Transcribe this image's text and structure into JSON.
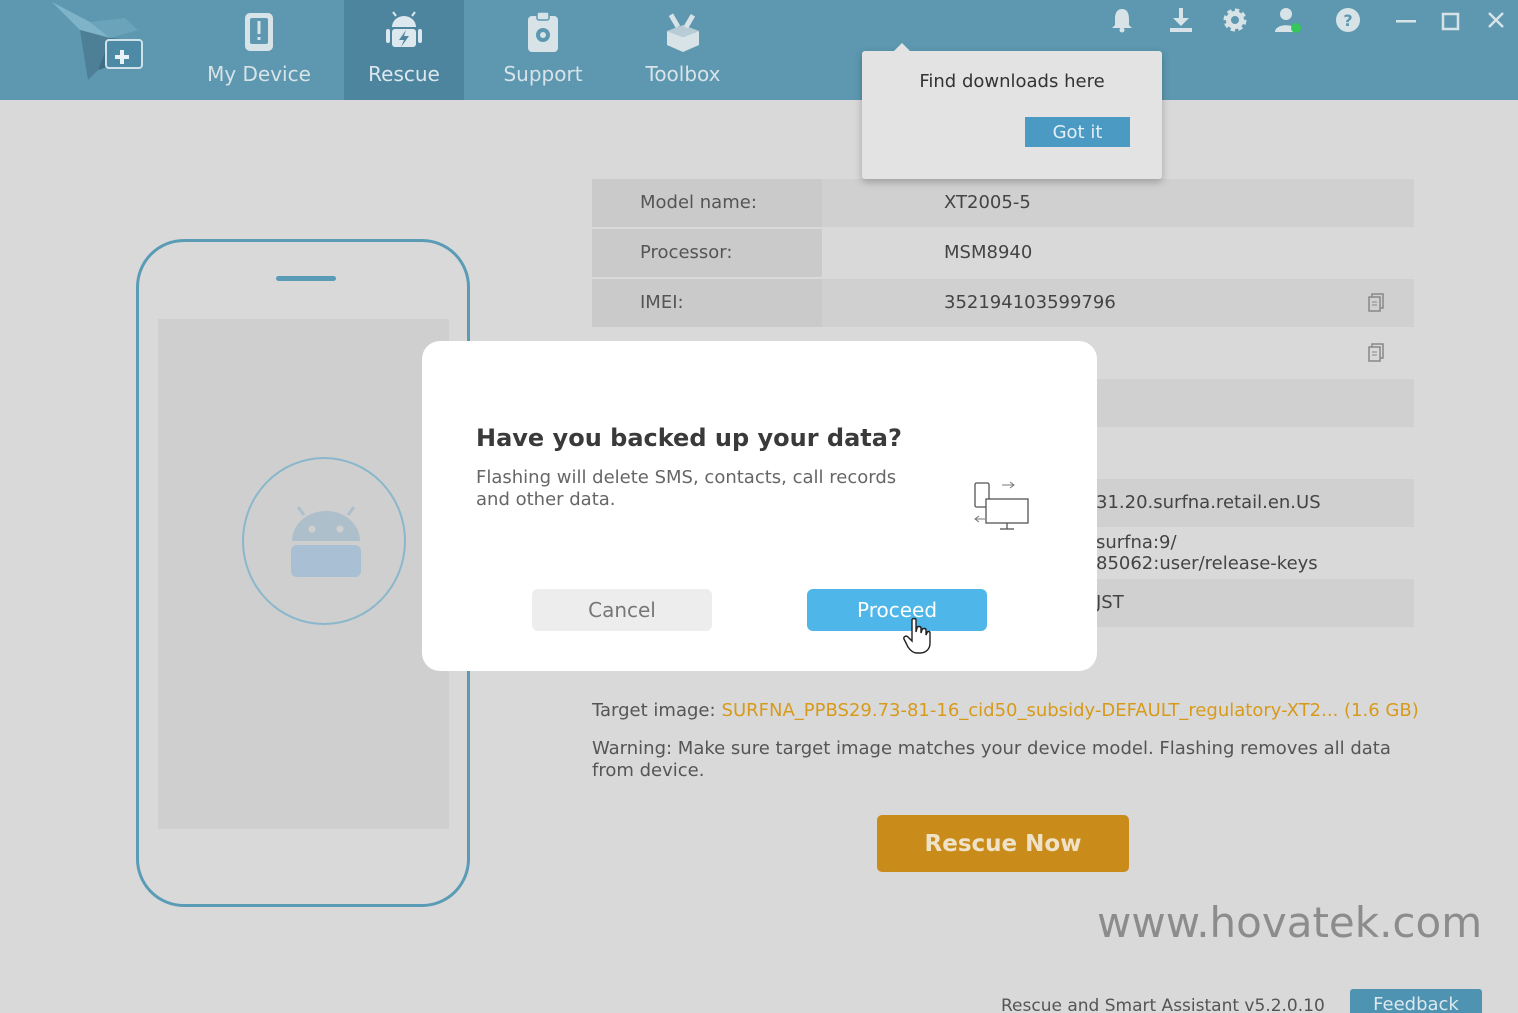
{
  "nav": {
    "tabs": [
      {
        "label": "My Device",
        "icon": "phone-alert-icon"
      },
      {
        "label": "Rescue",
        "icon": "android-bolt-icon"
      },
      {
        "label": "Support",
        "icon": "clipboard-gear-icon"
      },
      {
        "label": "Toolbox",
        "icon": "toolbox-icon"
      }
    ],
    "active_tab": "Rescue"
  },
  "header_icons": [
    "bell-icon",
    "download-icon",
    "gear-icon",
    "user-status-icon",
    "help-icon",
    "minimize-icon",
    "maximize-icon",
    "close-icon"
  ],
  "popover": {
    "text": "Find downloads here",
    "button_label": "Got it"
  },
  "device_info": {
    "rows": [
      {
        "label": "Model name:",
        "value": "XT2005-5"
      },
      {
        "label": "Processor:",
        "value": "MSM8940"
      },
      {
        "label": "IMEI:",
        "value": "352194103599796"
      }
    ],
    "partial_values": {
      "software": "31.20.surfna.retail.en.US",
      "fingerprint_line1": "surfna:9/",
      "fingerprint_line2": "85062:user/release-keys",
      "region": "JST"
    }
  },
  "target": {
    "label": "Target image:",
    "value": "SURFNA_PPBS29.73-81-16_cid50_subsidy-DEFAULT_regulatory-XT2... (1.6 GB)"
  },
  "warning": "Warning: Make sure target image matches your device model. Flashing removes all data from device.",
  "rescue_button": "Rescue Now",
  "watermark": "www.hovatek.com",
  "footer": {
    "version": "Rescue and Smart Assistant v5.2.0.10",
    "feedback": "Feedback"
  },
  "modal": {
    "title": "Have you backed up your data?",
    "text": "Flashing will delete SMS, contacts, call records and other data.",
    "cancel": "Cancel",
    "proceed": "Proceed"
  },
  "colors": {
    "header": "#5d98b0",
    "active_tab": "#4d859e",
    "accent_blue": "#4eb6e8",
    "rescue_orange": "#c98c1b",
    "target_orange": "#d79a1b"
  }
}
